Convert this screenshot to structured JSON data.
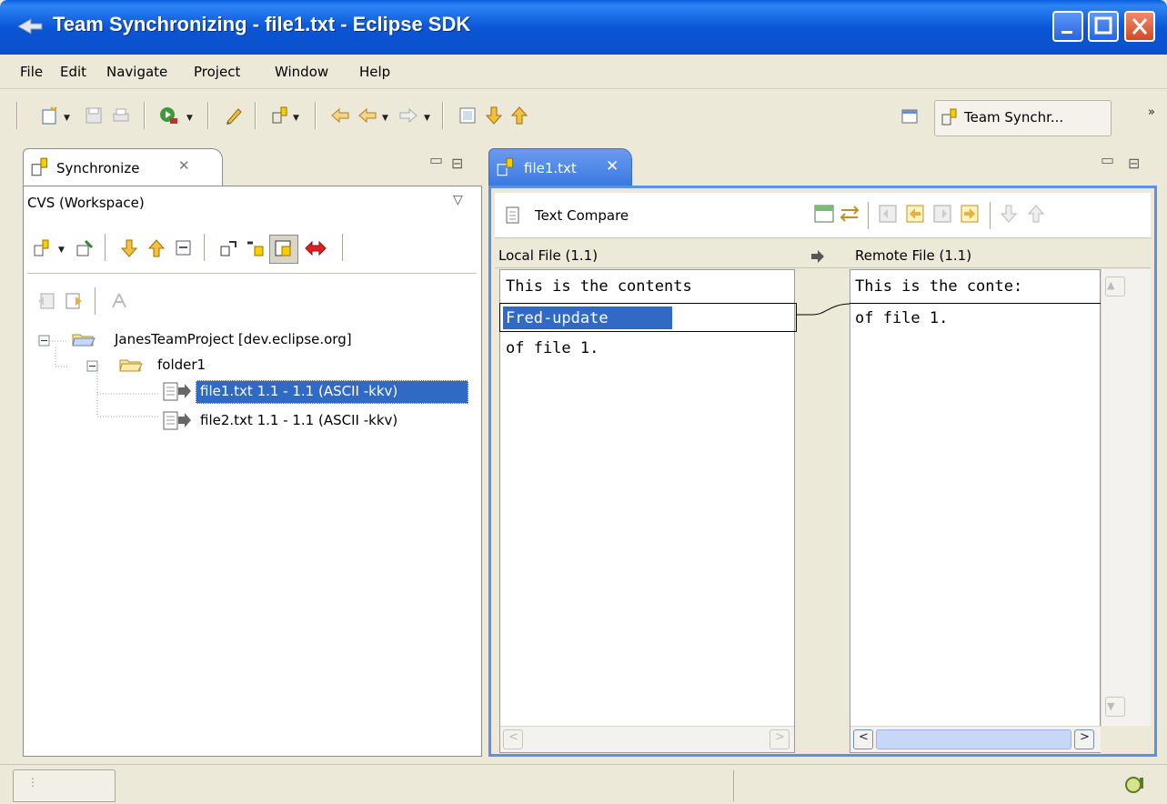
{
  "window": {
    "title": "Team Synchronizing - file1.txt - Eclipse SDK"
  },
  "menu": {
    "items": [
      "File",
      "Edit",
      "Navigate",
      "Project",
      "Window",
      "Help"
    ]
  },
  "toolbar": {
    "perspective_label": "Team Synchr..."
  },
  "sync_view": {
    "tab_label": "Synchronize",
    "participant": "CVS (Workspace)",
    "tree": [
      {
        "label": "JanesTeamProject  [dev.eclipse.org]"
      },
      {
        "label": "folder1"
      },
      {
        "label": "file1.txt  1.1 - 1.1  (ASCII -kkv)"
      },
      {
        "label": "file2.txt  1.1 - 1.1  (ASCII -kkv)"
      }
    ]
  },
  "editor": {
    "tab_label": "file1.txt",
    "compare_title": "Text Compare",
    "left_header": "Local File (1.1)",
    "right_header": "Remote File (1.1)",
    "left_lines": [
      "This is the contents",
      "Fred-update",
      "of file 1."
    ],
    "right_lines": [
      "This is the conte:",
      "of file 1."
    ]
  },
  "colors": {
    "selection": "#316ac5",
    "titlebar": "#0a56d8",
    "active_editor_border": "#5b8fe8"
  }
}
